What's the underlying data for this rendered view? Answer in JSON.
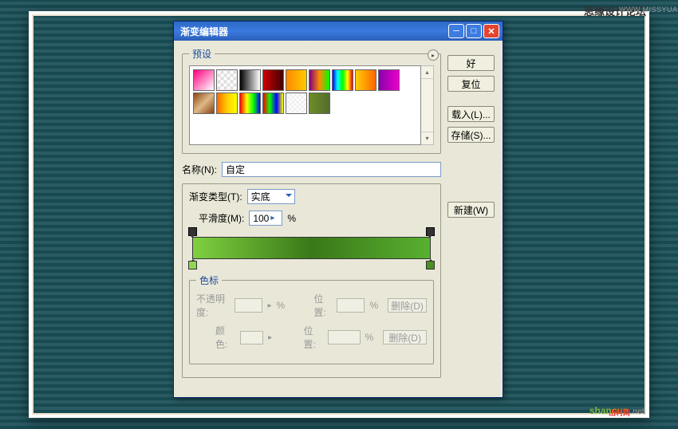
{
  "watermark": {
    "main": "思缘设计论坛",
    "sub": "WWW.MISSYUAN.COM"
  },
  "dialog": {
    "title": "渐变编辑器",
    "presets_label": "预设",
    "buttons": {
      "ok": "好",
      "reset": "复位",
      "load": "载入(L)...",
      "save": "存储(S)...",
      "new": "新建(W)"
    },
    "name": {
      "label": "名称(N):",
      "value": "自定"
    },
    "type": {
      "label": "渐变类型(T):",
      "value": "实底"
    },
    "smooth": {
      "label": "平滑度(M):",
      "value": "100",
      "unit": "%"
    },
    "stops": {
      "legend": "色标",
      "opacity_label": "不透明度:",
      "position_label": "位置:",
      "color_label": "颜色:",
      "delete": "删除(D)",
      "unit": "%"
    }
  },
  "logo": {
    "part1": "shan",
    "part2": "cun",
    "ext": ".net",
    "sub": "山村网"
  }
}
